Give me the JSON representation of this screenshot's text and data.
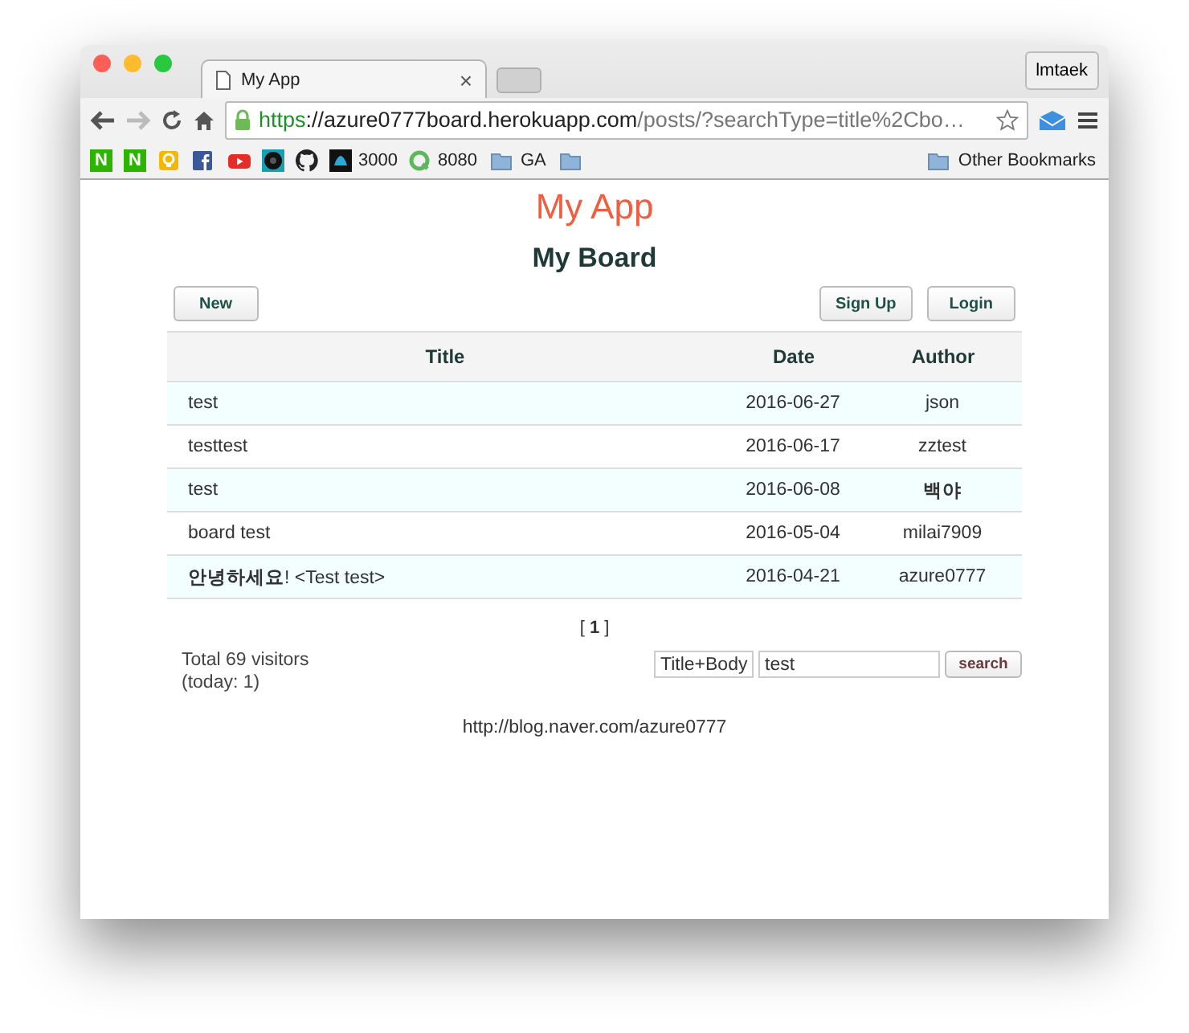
{
  "browser": {
    "tab_title": "My App",
    "tab_close": "×",
    "profile": "lmtaek",
    "url": {
      "scheme": "https",
      "rest_host": "://azure0777board.herokuapp.com",
      "path": "/posts/?searchType=title%2Cbo…"
    },
    "bookmarks": [
      {
        "kind": "tile",
        "glyph": "N",
        "color": "#2db400"
      },
      {
        "kind": "tile",
        "glyph": "N",
        "color": "#2db400"
      },
      {
        "kind": "bulb"
      },
      {
        "kind": "fb"
      },
      {
        "kind": "play"
      },
      {
        "kind": "disc"
      },
      {
        "kind": "cat"
      },
      {
        "kind": "square",
        "label": "3000"
      },
      {
        "kind": "ring",
        "label": "8080"
      },
      {
        "kind": "folder",
        "label": "GA"
      },
      {
        "kind": "folder"
      }
    ],
    "other_bookmarks": "Other Bookmarks"
  },
  "page": {
    "app_title": "My App",
    "board_title": "My Board",
    "buttons": {
      "new": "New",
      "sign_up": "Sign Up",
      "login": "Login"
    },
    "table": {
      "columns": [
        "Title",
        "Date",
        "Author"
      ],
      "rows": [
        {
          "title": "test",
          "date": "2016-06-27",
          "author": "json",
          "author_bold": false,
          "tinted": true
        },
        {
          "title": "testtest",
          "date": "2016-06-17",
          "author": "zztest",
          "author_bold": false,
          "tinted": false
        },
        {
          "title": "test",
          "date": "2016-06-08",
          "author": "백야",
          "author_bold": true,
          "tinted": true
        },
        {
          "title": "board test",
          "date": "2016-05-04",
          "author": "milai7909",
          "author_bold": false,
          "tinted": false
        },
        {
          "title": "**안녕하세요**! <Test test>",
          "date": "2016-04-21",
          "author": "azure0777",
          "author_bold": false,
          "tinted": true
        }
      ]
    },
    "pagination": "[ **1** ]",
    "visitors": [
      "Total 69 visitors",
      "(today: 1)"
    ],
    "search": {
      "type": "Title+Body",
      "value": "test",
      "button": "search"
    },
    "footer_link": "http://blog.naver.com/azure0777"
  }
}
